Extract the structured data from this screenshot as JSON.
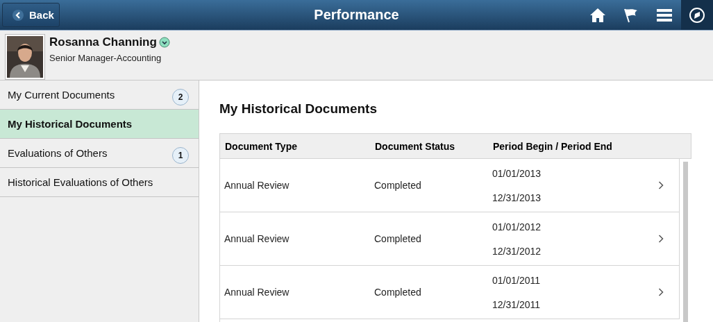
{
  "header": {
    "back": "Back",
    "title": "Performance"
  },
  "profile": {
    "name": "Rosanna Channing",
    "job": "Senior Manager-Accounting"
  },
  "sidebar": {
    "items": [
      {
        "label": "My Current Documents",
        "count": "2",
        "selected": false
      },
      {
        "label": "My Historical Documents",
        "selected": true
      },
      {
        "label": "Evaluations of Others",
        "count": "1",
        "selected": false
      },
      {
        "label": "Historical Evaluations of Others",
        "selected": false
      }
    ]
  },
  "main": {
    "title": "My Historical Documents",
    "table": {
      "columns": [
        "Document Type",
        "Document Status",
        "Period Begin / Period End"
      ],
      "rows": [
        {
          "type": "Annual Review",
          "status": "Completed",
          "begin": "01/01/2013",
          "end": "12/31/2013"
        },
        {
          "type": "Annual Review",
          "status": "Completed",
          "begin": "01/01/2012",
          "end": "12/31/2012"
        },
        {
          "type": "Annual Review",
          "status": "Completed",
          "begin": "01/01/2011",
          "end": "12/31/2011"
        }
      ]
    }
  }
}
